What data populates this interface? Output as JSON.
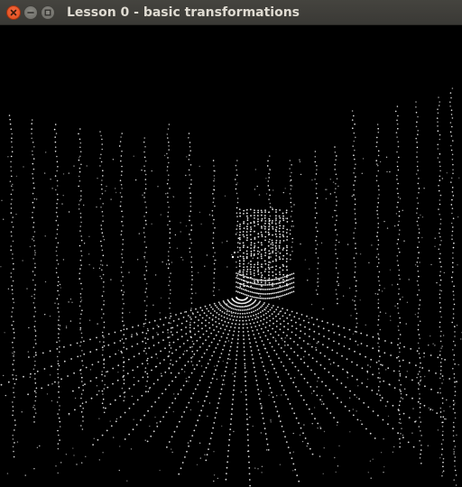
{
  "window": {
    "title": "Lesson 0 - basic transformations",
    "controls": [
      "close-icon",
      "minimize-icon",
      "maximize-icon"
    ],
    "accent_close": "#df4a16",
    "titlebar_color": "#3c3b37",
    "title_color": "#dfdbd2"
  },
  "viewport": {
    "background": "#000000",
    "point_color": "#ffffff",
    "content": "lidar-point-cloud"
  }
}
